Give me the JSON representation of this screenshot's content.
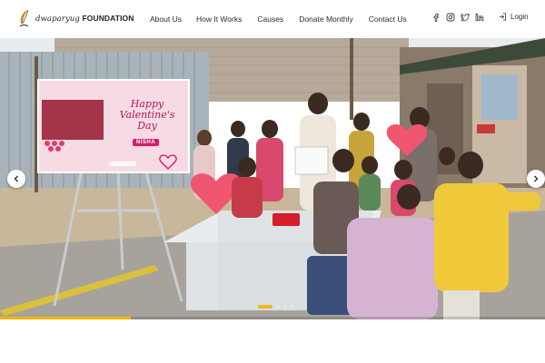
{
  "brand": {
    "line1": "dwaparyug",
    "line2": "FOUNDATION",
    "accent_color": "#f2b500"
  },
  "nav": {
    "items": [
      {
        "label": "About Us"
      },
      {
        "label": "How It Works"
      },
      {
        "label": "Causes"
      },
      {
        "label": "Donate Monthly"
      },
      {
        "label": "Contact Us"
      }
    ]
  },
  "social": {
    "icons": [
      "facebook-icon",
      "instagram-icon",
      "twitter-icon",
      "linkedin-icon"
    ]
  },
  "login": {
    "label": "Login",
    "icon": "login-icon"
  },
  "hero": {
    "banner": {
      "line1": "Happy",
      "line2": "Valentine's",
      "line3": "Day",
      "name": "NISHA"
    },
    "slider": {
      "slide_count": 4,
      "active_index": 0,
      "progress": 0.24
    },
    "prev_icon": "chevron-left-icon",
    "next_icon": "chevron-right-icon"
  }
}
